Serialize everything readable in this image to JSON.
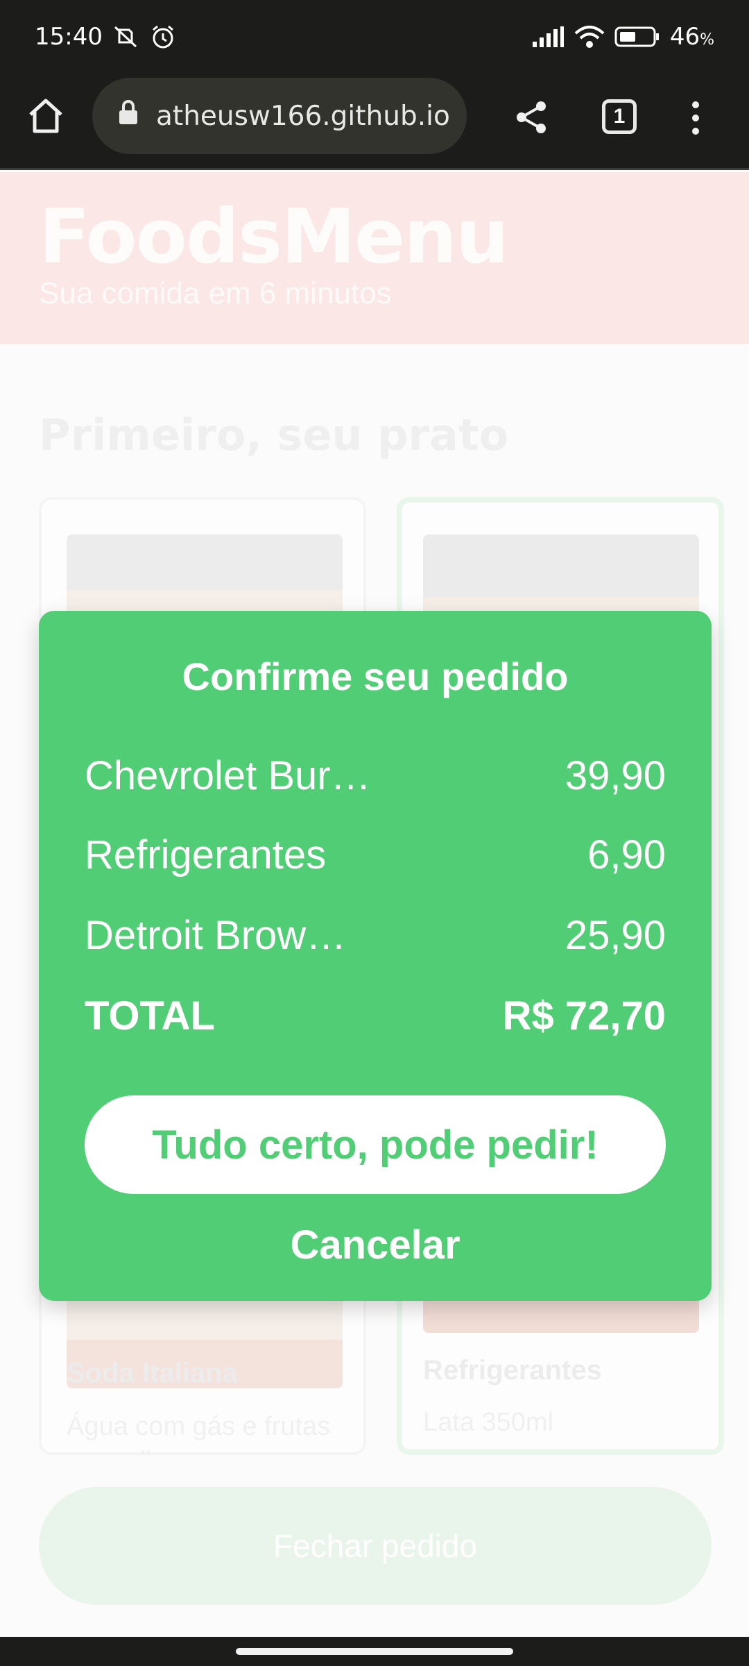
{
  "status_bar": {
    "time": "15:40",
    "battery": "46",
    "battery_unit": "%",
    "icons": [
      "mute-vibrate-icon",
      "alarm-icon",
      "signal-icon",
      "wifi-icon",
      "battery-icon"
    ]
  },
  "browser": {
    "url": "atheusw166.github.io",
    "tab_count": "1",
    "icons": [
      "home-icon",
      "lock-icon",
      "share-icon",
      "tabs-icon",
      "more-vertical-icon"
    ]
  },
  "header": {
    "logo": "FoodsMenu",
    "tagline": "Sua comida em 6 minutos"
  },
  "page": {
    "section_title": "Primeiro, seu prato",
    "cards": [
      {
        "name": "Soda Italiana",
        "desc": "Água com gás e frutas vermelhas",
        "selected": false
      },
      {
        "name": "Refrigerantes",
        "desc": "Lata 350ml",
        "selected": true
      }
    ],
    "close_order_label": "Fechar pedido"
  },
  "modal": {
    "title": "Confirme seu pedido",
    "items": [
      {
        "name": "Chevrolet Bur…",
        "price": "39,90"
      },
      {
        "name": "Refrigerantes",
        "price": "6,90"
      },
      {
        "name": "Detroit Brow…",
        "price": "25,90"
      }
    ],
    "total_label": "TOTAL",
    "total_value": "R$ 72,70",
    "confirm_label": "Tudo certo, pode pedir!",
    "cancel_label": "Cancelar"
  },
  "colors": {
    "accent_green": "#51ce75",
    "header_pink": "#fae7e6",
    "browser_dark": "#1c1c1a"
  }
}
